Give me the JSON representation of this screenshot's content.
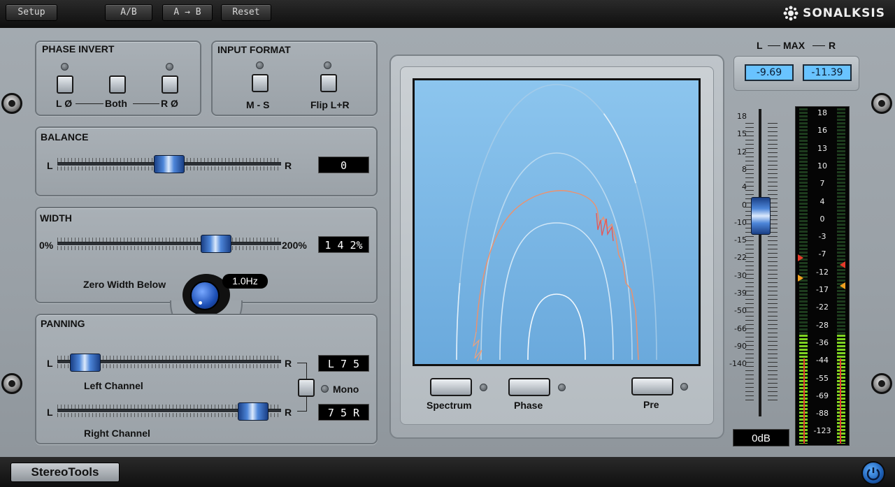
{
  "toolbar": {
    "setup": "Setup",
    "ab": "A/B",
    "a_to_b": "A → B",
    "reset": "Reset"
  },
  "brand": {
    "logo_text": "SONALKSIS",
    "plugin_name": "StereoTools"
  },
  "phase_invert": {
    "title": "PHASE INVERT",
    "left": "L Ø",
    "both": "Both",
    "right": "R Ø"
  },
  "input_format": {
    "title": "INPUT FORMAT",
    "ms": "M - S",
    "flip": "Flip L+R"
  },
  "balance": {
    "title": "BALANCE",
    "left": "L",
    "right": "R",
    "value": "0",
    "position": 0.5
  },
  "width": {
    "title": "WIDTH",
    "min": "0%",
    "max": "200%",
    "value": "1 4 2%",
    "position": 0.71,
    "zero_width_label": "Zero Width Below",
    "zero_width_value": "1.0Hz"
  },
  "panning": {
    "title": "PANNING",
    "left_channel": {
      "label": "Left Channel",
      "l": "L",
      "r": "R",
      "value": "L 7 5",
      "position": 0.125
    },
    "right_channel": {
      "label": "Right Channel",
      "l": "L",
      "r": "R",
      "value": "7 5 R",
      "position": 0.875
    },
    "mono": "Mono"
  },
  "display": {
    "spectrum": "Spectrum",
    "phase": "Phase",
    "pre": "Pre"
  },
  "max": {
    "label_l": "L",
    "label_max": "MAX",
    "label_r": "R",
    "left_value": "-9.69",
    "right_value": "-11.39"
  },
  "fader": {
    "scale": [
      "18",
      "15",
      "12",
      "8",
      "4",
      "0",
      "-10",
      "-15",
      "-22",
      "-30",
      "-39",
      "-50",
      "-66",
      "-90",
      "-140"
    ],
    "readout": "0dB",
    "level": "0"
  },
  "meter": {
    "scale": [
      "18",
      "16",
      "13",
      "10",
      "7",
      "4",
      "0",
      "-3",
      "-7",
      "-12",
      "-17",
      "-22",
      "-28",
      "-36",
      "-44",
      "-55",
      "-69",
      "-88",
      "-123"
    ]
  },
  "colors": {
    "accent_blue": "#69c3ff",
    "screen_blue": "#79b6e6",
    "trace_orange": "#f0906a",
    "meter_green": "#7ed321",
    "meter_red": "#e53a2a"
  }
}
